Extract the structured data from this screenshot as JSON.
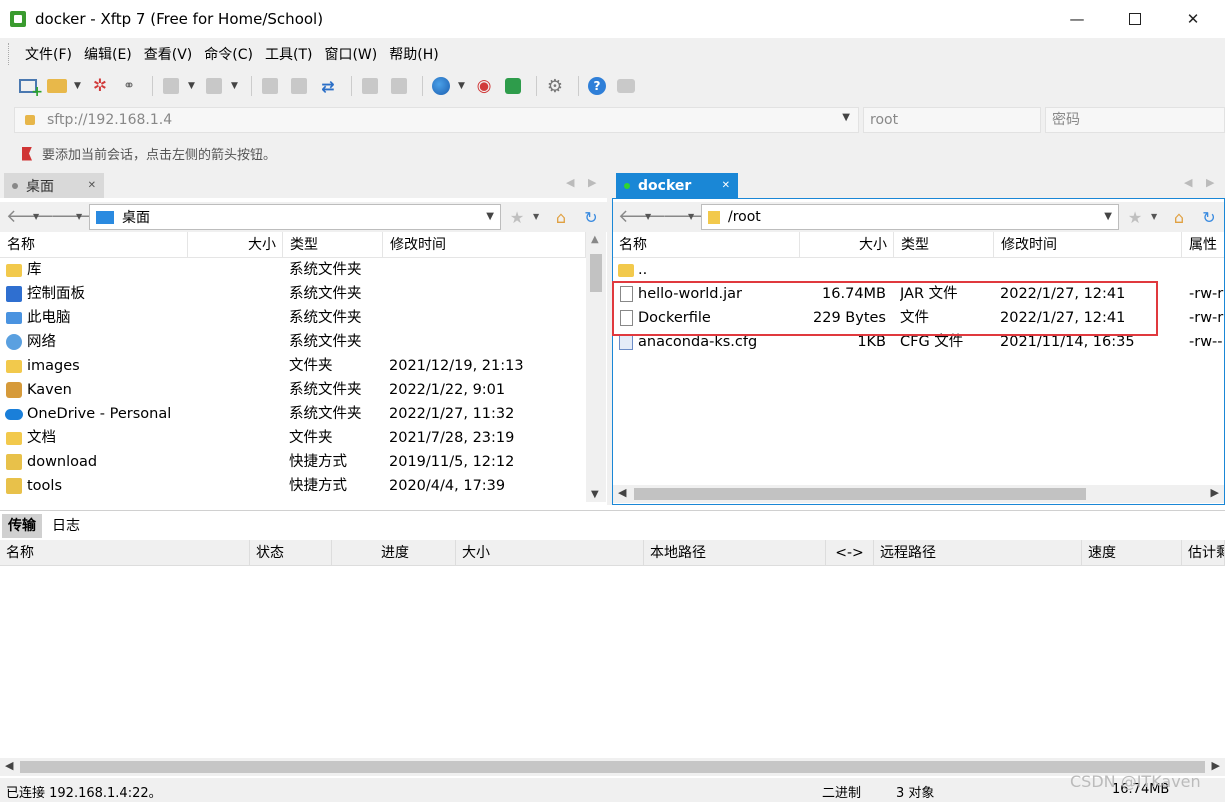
{
  "window": {
    "title": "docker - Xftp 7 (Free for Home/School)"
  },
  "menu": [
    "文件(F)",
    "编辑(E)",
    "查看(V)",
    "命令(C)",
    "工具(T)",
    "窗口(W)",
    "帮助(H)"
  ],
  "address": {
    "host": "sftp://192.168.1.4",
    "user_placeholder": "root",
    "password_placeholder": "密码"
  },
  "hint": "要添加当前会话，点击左侧的箭头按钮。",
  "left_pane": {
    "tab": "桌面",
    "path": "桌面",
    "columns": [
      "名称",
      "大小",
      "类型",
      "修改时间"
    ],
    "rows": [
      {
        "name": "库",
        "size": "",
        "type": "系统文件夹",
        "modified": "",
        "icon": "library-icon"
      },
      {
        "name": "控制面板",
        "size": "",
        "type": "系统文件夹",
        "modified": "",
        "icon": "control-panel-icon"
      },
      {
        "name": "此电脑",
        "size": "",
        "type": "系统文件夹",
        "modified": "",
        "icon": "computer-icon"
      },
      {
        "name": "网络",
        "size": "",
        "type": "系统文件夹",
        "modified": "",
        "icon": "network-icon"
      },
      {
        "name": "images",
        "size": "",
        "type": "文件夹",
        "modified": "2021/12/19, 21:13",
        "icon": "folder-icon"
      },
      {
        "name": "Kaven",
        "size": "",
        "type": "系统文件夹",
        "modified": "2022/1/22, 9:01",
        "icon": "user-folder-icon"
      },
      {
        "name": "OneDrive - Personal",
        "size": "",
        "type": "系统文件夹",
        "modified": "2022/1/27, 11:32",
        "icon": "onedrive-icon"
      },
      {
        "name": "文档",
        "size": "",
        "type": "文件夹",
        "modified": "2021/7/28, 23:19",
        "icon": "folder-icon"
      },
      {
        "name": "download",
        "size": "",
        "type": "快捷方式",
        "modified": "2019/11/5, 12:12",
        "icon": "shortcut-icon"
      },
      {
        "name": "tools",
        "size": "",
        "type": "快捷方式",
        "modified": "2020/4/4, 17:39",
        "icon": "shortcut-icon"
      }
    ]
  },
  "right_pane": {
    "tab": "docker",
    "path": "/root",
    "columns": [
      "名称",
      "大小",
      "类型",
      "修改时间",
      "属性"
    ],
    "rows": [
      {
        "name": "..",
        "size": "",
        "type": "",
        "modified": "",
        "attr": "",
        "icon": "folder-icon"
      },
      {
        "name": "hello-world.jar",
        "size": "16.74MB",
        "type": "JAR 文件",
        "modified": "2022/1/27, 12:41",
        "attr": "-rw-r",
        "icon": "file-icon"
      },
      {
        "name": "Dockerfile",
        "size": "229 Bytes",
        "type": "文件",
        "modified": "2022/1/27, 12:41",
        "attr": "-rw-r",
        "icon": "file-icon"
      },
      {
        "name": "anaconda-ks.cfg",
        "size": "1KB",
        "type": "CFG 文件",
        "modified": "2021/11/14, 16:35",
        "attr": "-rw--",
        "icon": "cfg-file-icon"
      }
    ]
  },
  "transfer": {
    "tabs": [
      "传输",
      "日志"
    ],
    "columns": [
      "名称",
      "状态",
      "进度",
      "大小",
      "本地路径",
      "<->",
      "远程路径",
      "速度",
      "估计剩"
    ]
  },
  "status": {
    "connection": "已连接 192.168.1.4:22。",
    "mode": "二进制",
    "objects": "3 对象",
    "size": "16.74MB"
  },
  "watermark": "CSDN @ITKaven"
}
